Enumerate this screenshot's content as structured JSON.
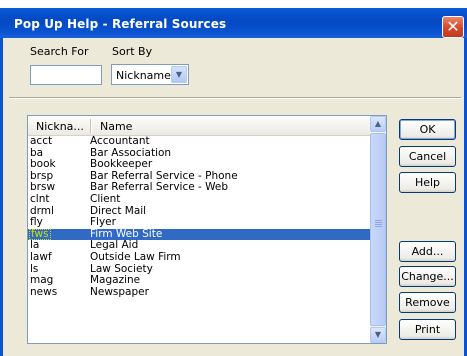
{
  "window": {
    "title": "Pop Up Help - Referral Sources",
    "close_symbol": "✕"
  },
  "search": {
    "label": "Search For",
    "value": ""
  },
  "sort": {
    "label": "Sort By",
    "selected": "Nickname",
    "arrow": "▼"
  },
  "list": {
    "columns": [
      "Nickna...",
      "Name"
    ],
    "rows": [
      {
        "nick": "acct",
        "name": "Accountant"
      },
      {
        "nick": "ba",
        "name": "Bar Association"
      },
      {
        "nick": "book",
        "name": "Bookkeeper"
      },
      {
        "nick": "brsp",
        "name": "Bar Referral Service - Phone"
      },
      {
        "nick": "brsw",
        "name": "Bar Referral Service - Web"
      },
      {
        "nick": "clnt",
        "name": "Client"
      },
      {
        "nick": "drml",
        "name": "Direct Mail"
      },
      {
        "nick": "fly",
        "name": "Flyer"
      },
      {
        "nick": "fws",
        "name": "Firm Web Site"
      },
      {
        "nick": "la",
        "name": "Legal Aid"
      },
      {
        "nick": "lawf",
        "name": "Outside Law Firm"
      },
      {
        "nick": "ls",
        "name": "Law Society"
      },
      {
        "nick": "mag",
        "name": "Magazine"
      },
      {
        "nick": "news",
        "name": "Newspaper"
      }
    ],
    "selected_nick": "fws",
    "scroll_up": "▲",
    "scroll_down": "▼"
  },
  "buttons": {
    "ok": "OK",
    "cancel": "Cancel",
    "help": "Help",
    "add": "Add...",
    "change": "Change...",
    "remove": "Remove",
    "print": "Print"
  },
  "colors": {
    "titlebar": "#0a52d0",
    "selection": "#316ac5",
    "close": "#d5472b"
  }
}
